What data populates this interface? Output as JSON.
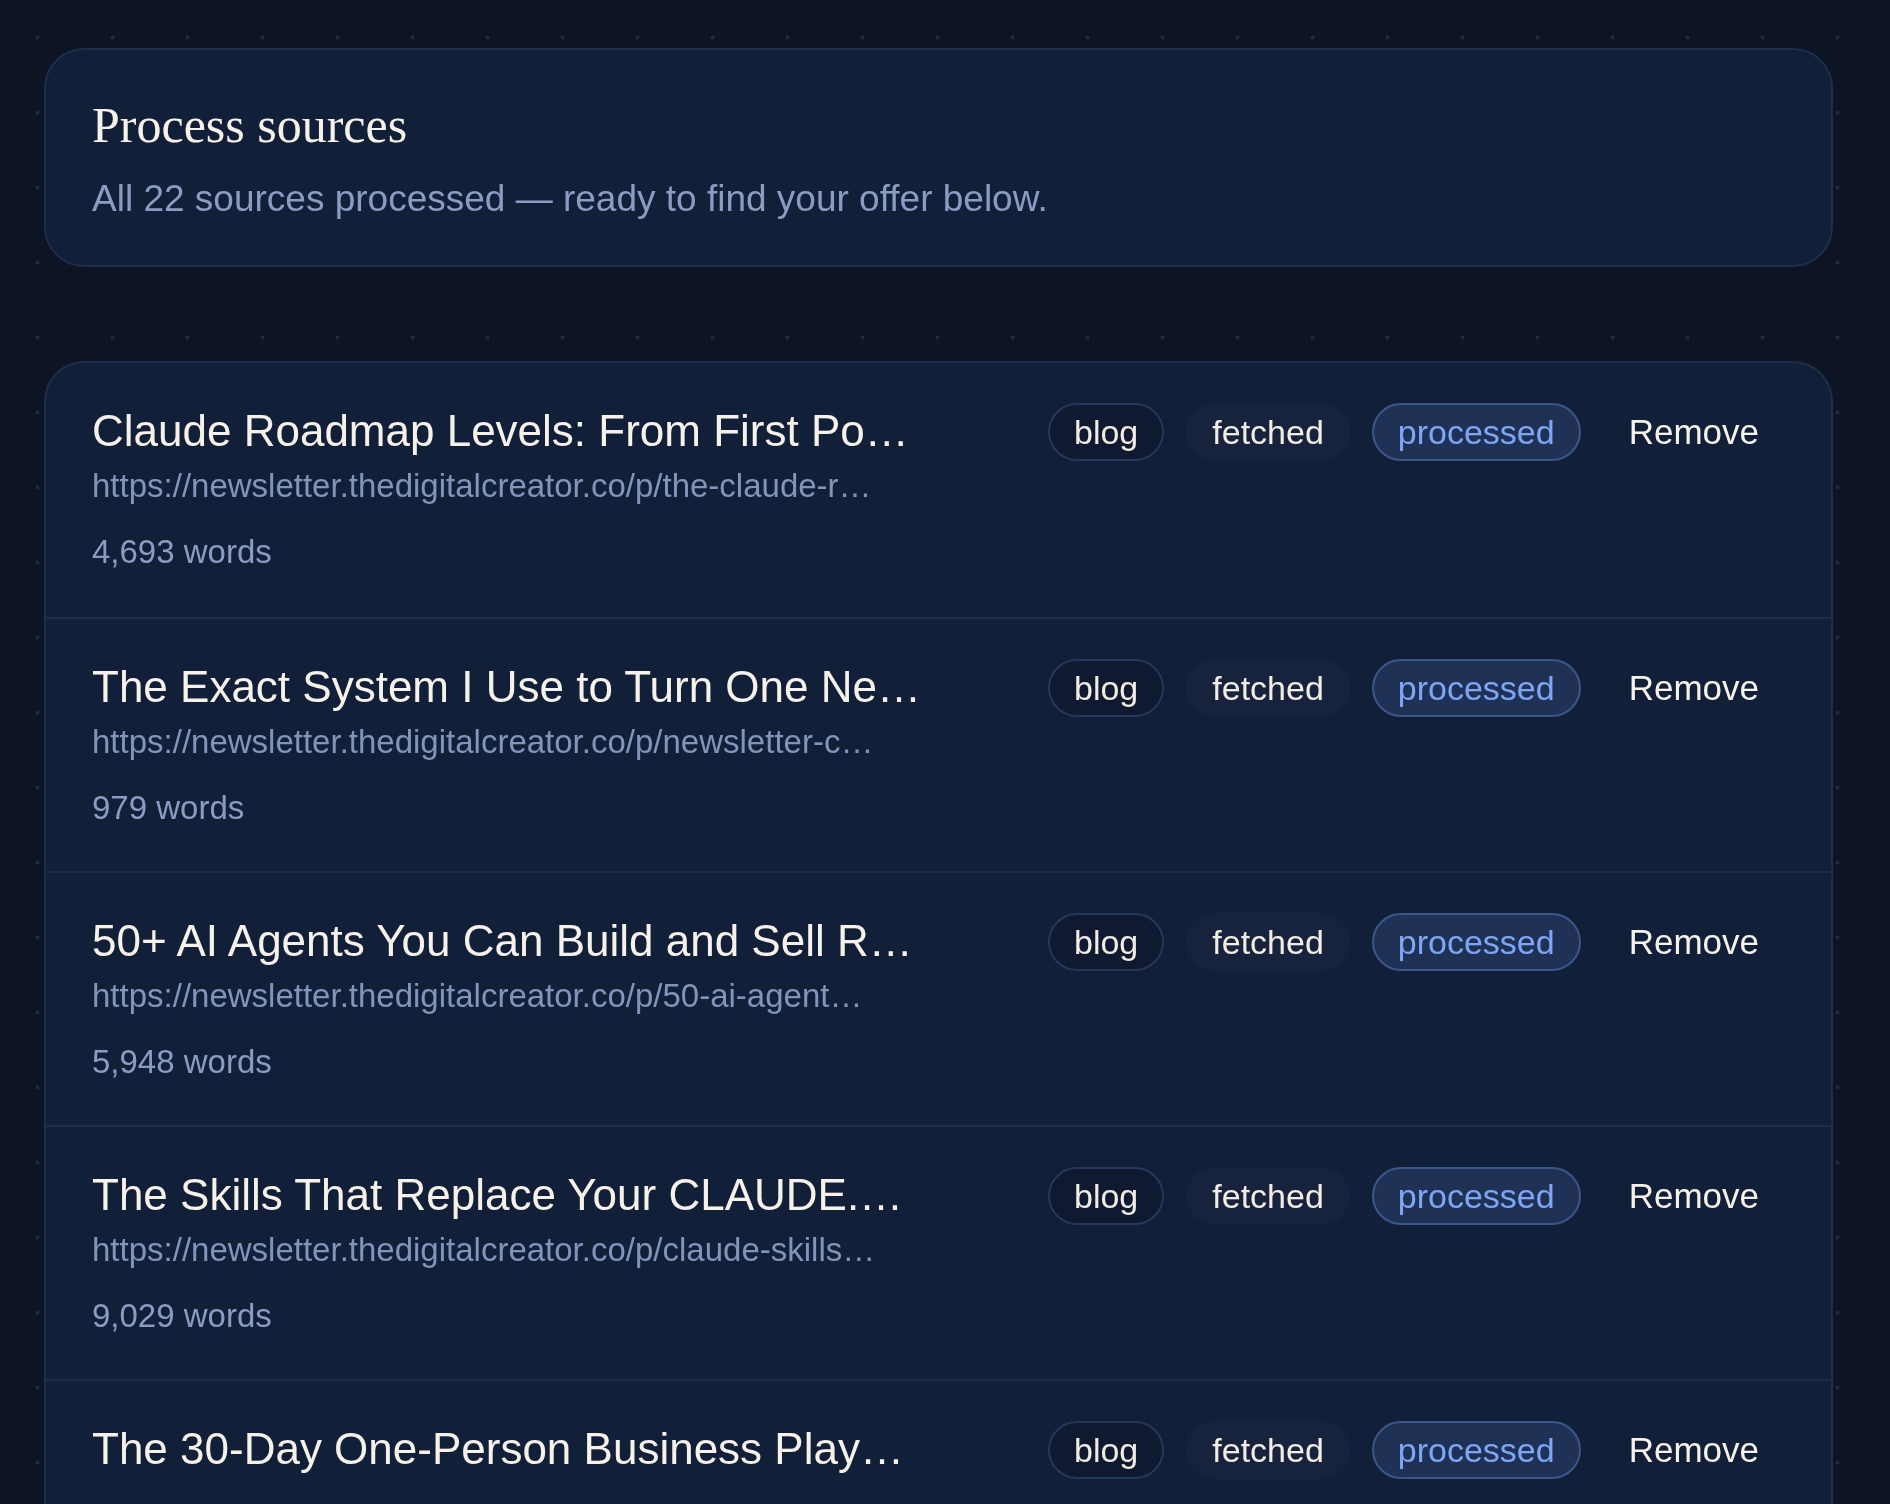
{
  "header": {
    "title": "Process sources",
    "subtitle": "All 22 sources processed — ready to find your offer below."
  },
  "sources": [
    {
      "title": "Claude Roadmap Levels: From First Po…",
      "url": "https://newsletter.thedigitalcreator.co/p/the-claude-r…",
      "words": "4,693 words",
      "tags": [
        {
          "label": "blog",
          "kind": "outline"
        },
        {
          "label": "fetched",
          "kind": "filled"
        },
        {
          "label": "processed",
          "kind": "accent"
        }
      ],
      "action": "Remove"
    },
    {
      "title": "The Exact System I Use to Turn One Ne…",
      "url": "https://newsletter.thedigitalcreator.co/p/newsletter-c…",
      "words": "979 words",
      "tags": [
        {
          "label": "blog",
          "kind": "outline"
        },
        {
          "label": "fetched",
          "kind": "filled"
        },
        {
          "label": "processed",
          "kind": "accent"
        }
      ],
      "action": "Remove"
    },
    {
      "title": "50+ AI Agents You Can Build and Sell R…",
      "url": "https://newsletter.thedigitalcreator.co/p/50-ai-agent…",
      "words": "5,948 words",
      "tags": [
        {
          "label": "blog",
          "kind": "outline"
        },
        {
          "label": "fetched",
          "kind": "filled"
        },
        {
          "label": "processed",
          "kind": "accent"
        }
      ],
      "action": "Remove"
    },
    {
      "title": "The Skills That Replace Your CLAUDE.…",
      "url": "https://newsletter.thedigitalcreator.co/p/claude-skills…",
      "words": "9,029 words",
      "tags": [
        {
          "label": "blog",
          "kind": "outline"
        },
        {
          "label": "fetched",
          "kind": "filled"
        },
        {
          "label": "processed",
          "kind": "accent"
        }
      ],
      "action": "Remove"
    },
    {
      "title": "The 30-Day One-Person Business Play…",
      "tags": [
        {
          "label": "blog",
          "kind": "outline"
        },
        {
          "label": "fetched",
          "kind": "filled"
        },
        {
          "label": "processed",
          "kind": "accent"
        }
      ],
      "action": "Remove"
    }
  ]
}
